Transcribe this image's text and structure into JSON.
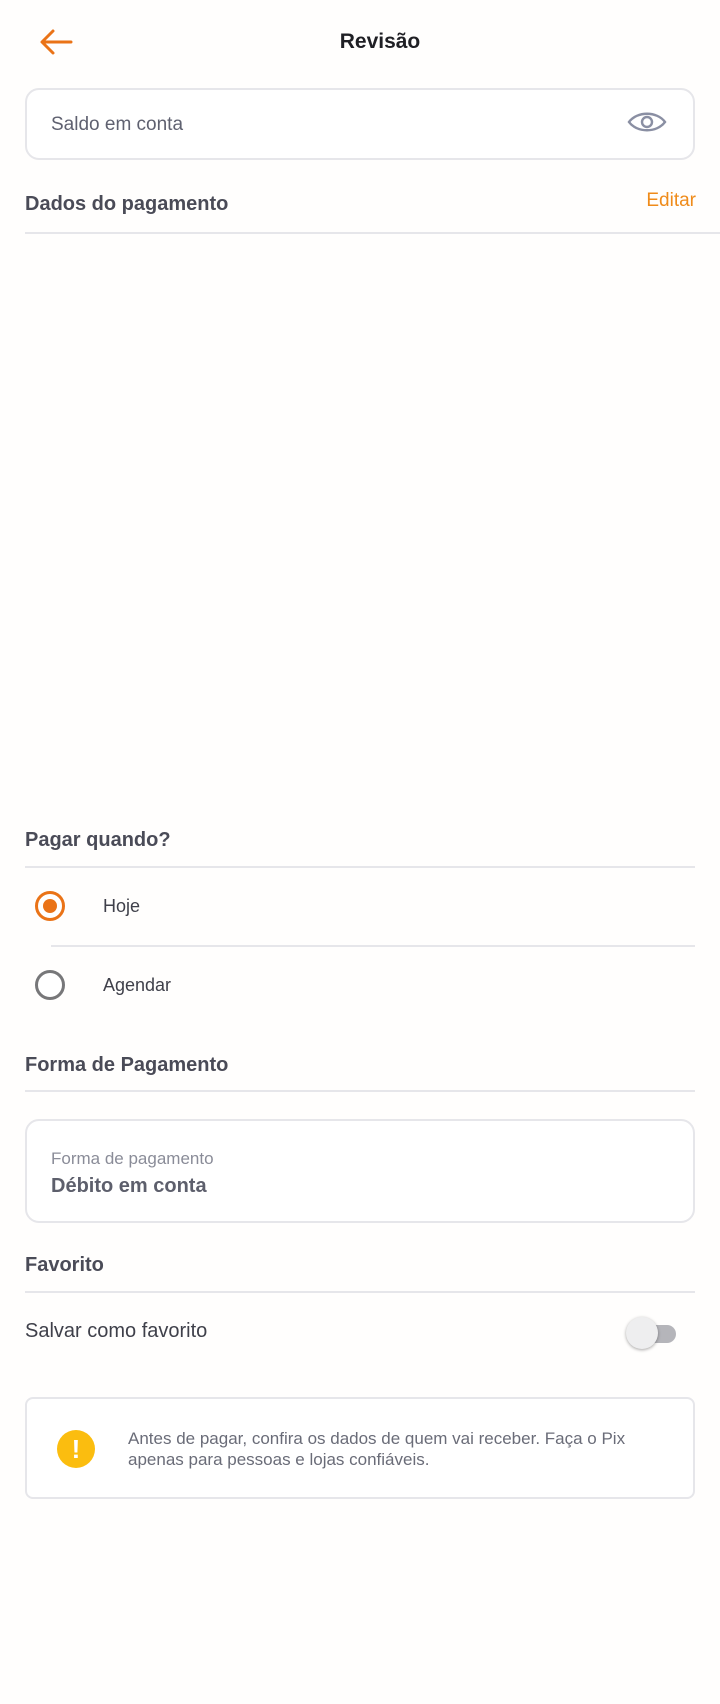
{
  "header": {
    "title": "Revisão",
    "back_icon": "arrow-left-icon",
    "accent_color": "#ea7317"
  },
  "balance": {
    "label": "Saldo em conta",
    "toggle_icon": "eye-icon"
  },
  "payment_data": {
    "title": "Dados do pagamento",
    "edit_label": "Editar"
  },
  "when": {
    "title": "Pagar quando?",
    "options": [
      {
        "label": "Hoje",
        "selected": true
      },
      {
        "label": "Agendar",
        "selected": false
      }
    ]
  },
  "method": {
    "title": "Forma de Pagamento",
    "caption": "Forma de pagamento",
    "value": "Débito em conta"
  },
  "favorite": {
    "title": "Favorito",
    "label": "Salvar como favorito",
    "enabled": false
  },
  "alert": {
    "icon": "warning-icon",
    "icon_glyph": "!",
    "text": "Antes de pagar, confira os dados de quem vai receber. Faça o Pix apenas para pessoas e lojas confiáveis."
  }
}
